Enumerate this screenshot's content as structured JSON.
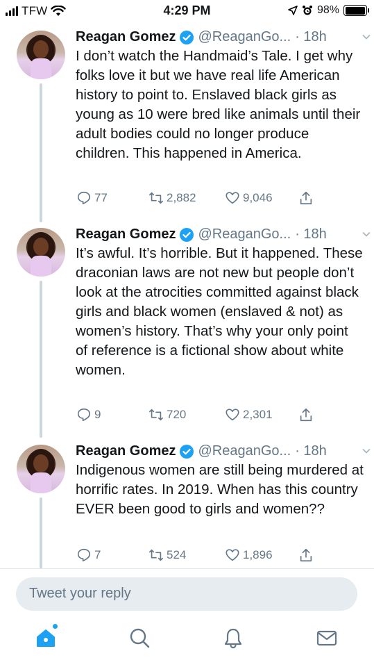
{
  "status_bar": {
    "carrier": "TFW",
    "time": "4:29 PM",
    "battery": "98%",
    "battery_level": 0.98
  },
  "tweets": [
    {
      "name": "Reagan Gomez",
      "handle": "@ReaganGo...",
      "time": "· 18h",
      "text": "I don’t watch the Handmaid’s Tale. I get why folks love it but we have real life American history to point to. Enslaved black girls as young as 10 were bred like animals until their adult bodies could no longer produce children. This happened in America.",
      "replies": "77",
      "retweets": "2,882",
      "likes": "9,046"
    },
    {
      "name": "Reagan Gomez",
      "handle": "@ReaganGo...",
      "time": "· 18h",
      "text": "It’s awful. It’s horrible. But it happened. These draconian laws are not new but people don’t look at the atrocities committed against black girls and black women (enslaved & not) as women’s history. That’s why your only point of reference is a fictional show about white women.",
      "replies": "9",
      "retweets": "720",
      "likes": "2,301"
    },
    {
      "name": "Reagan Gomez",
      "handle": "@ReaganGo...",
      "time": "· 18h",
      "text": "Indigenous women are still being murdered at horrific rates. In 2019. When has this country EVER been good to girls and women??",
      "replies": "7",
      "retweets": "524",
      "likes": "1,896"
    }
  ],
  "reply": {
    "placeholder": "Tweet your reply"
  },
  "tabbar": {
    "items": [
      "home-icon",
      "search-icon",
      "notifications-icon",
      "messages-icon"
    ]
  },
  "colors": {
    "accent": "#1da1f2",
    "muted": "#657786",
    "thread_line": "#ccd6dd"
  }
}
